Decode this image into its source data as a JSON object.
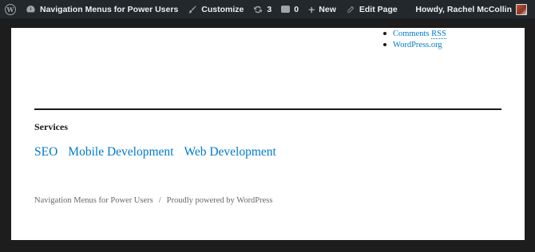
{
  "adminbar": {
    "site_name": "Navigation Menus for Power Users",
    "customize": "Customize",
    "updates_count": "3",
    "comments_count": "0",
    "new_label": "New",
    "edit_page": "Edit Page",
    "howdy": "Howdy, Rachel McCollin",
    "icons": [
      "wordpress-icon",
      "dashboard-icon",
      "brush-icon",
      "updates-icon",
      "comment-icon",
      "plus-icon",
      "pencil-icon",
      "avatar"
    ],
    "background_color": "#23282d"
  },
  "meta_widget": {
    "items": [
      "Comments RSS",
      "WordPress.org"
    ],
    "comments_rss_prefix": "Comments ",
    "comments_rss_abbr": "RSS"
  },
  "services": {
    "title": "Services",
    "links": [
      "SEO",
      "Mobile Development",
      "Web Development"
    ]
  },
  "footer": {
    "site_title": "Navigation Menus for Power Users",
    "separator": "/",
    "powered_by": "Proudly powered by WordPress"
  },
  "colors": {
    "link": "#007acc",
    "text": "#1a1a1a",
    "muted": "#686868",
    "frame": "#1d1d1d"
  }
}
